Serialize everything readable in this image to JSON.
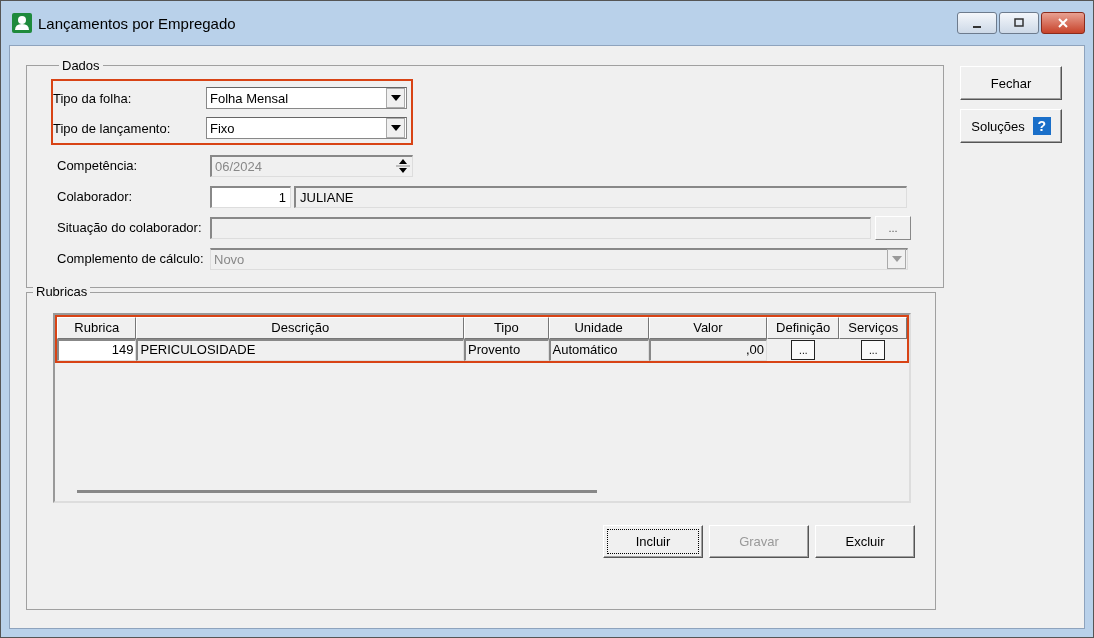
{
  "window": {
    "title": "Lançamentos por Empregado"
  },
  "dados": {
    "title": "Dados",
    "groups": [
      {
        "highlighted": true,
        "fields": [
          {
            "kind": "select",
            "label": "Tipo da folha:",
            "value": "Folha Mensal",
            "disabled": false
          },
          {
            "kind": "select",
            "label": "Tipo de lançamento:",
            "value": "Fixo",
            "disabled": false
          }
        ]
      },
      {
        "highlighted": false,
        "fields": [
          {
            "kind": "spinner",
            "label": "Competência:",
            "value": "06/2024",
            "disabled": true
          },
          {
            "kind": "code_name",
            "label": "Colaborador:",
            "code": "1",
            "value": "JULIANE",
            "disabled": false
          },
          {
            "kind": "text_button",
            "label": "Situação do colaborador:",
            "button": "...",
            "disabled": true
          },
          {
            "kind": "select",
            "label": "Complemento de cálculo:",
            "value": "Novo",
            "disabled": true
          }
        ]
      }
    ]
  },
  "rubricas": {
    "title": "Rubricas",
    "highlighted": true,
    "columns": [
      "Rubrica",
      "Descrição",
      "Tipo",
      "Unidade",
      "Valor",
      "Definição",
      "Serviços"
    ],
    "rows": [
      {
        "rubrica": "149",
        "descricao": "PERICULOSIDADE",
        "tipo": "Provento",
        "unidade": "Automático",
        "valor": ",00",
        "definicao": "...",
        "servicos": "..."
      }
    ]
  },
  "side_buttons": [
    {
      "kind": "text",
      "label": "Fechar"
    },
    {
      "kind": "help",
      "label": "Soluções",
      "icon_text": "?"
    }
  ],
  "bottom_buttons": [
    {
      "label": "Incluir",
      "disabled": false,
      "focused": true
    },
    {
      "label": "Gravar",
      "disabled": true,
      "focused": false
    },
    {
      "label": "Excluir",
      "disabled": false,
      "focused": false
    }
  ]
}
